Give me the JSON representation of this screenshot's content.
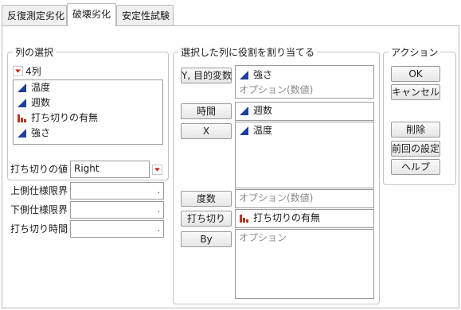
{
  "tabs": [
    "反復測定劣化",
    "破壊劣化",
    "安定性試験"
  ],
  "column_select": {
    "title": "列の選択",
    "count_label": "4列",
    "columns": [
      {
        "label": "温度",
        "icon": "continuous-icon"
      },
      {
        "label": "週数",
        "icon": "continuous-icon"
      },
      {
        "label": "打ち切りの有無",
        "icon": "nominal-bar-icon"
      },
      {
        "label": "強さ",
        "icon": "continuous-icon"
      }
    ]
  },
  "censor_value": {
    "label": "打ち切りの値",
    "value": "Right"
  },
  "upper_spec": {
    "label": "上側仕様限界",
    "value": "."
  },
  "lower_spec": {
    "label": "下側仕様限界",
    "value": "."
  },
  "censor_time": {
    "label": "打ち切り時間",
    "value": "."
  },
  "assign_roles": {
    "title": "選択した列に役割を割り当てる",
    "roles": {
      "y": {
        "button": "Y, 目的変数",
        "items": [
          "強さ"
        ],
        "placeholder": "オプション(数値)"
      },
      "time": {
        "button": "時間",
        "items": [
          "週数"
        ]
      },
      "x": {
        "button": "X",
        "items": [
          "温度"
        ]
      },
      "freq": {
        "button": "度数",
        "placeholder": "オプション(数値)"
      },
      "censor": {
        "button": "打ち切り",
        "items": [
          "打ち切りの有無"
        ]
      },
      "by": {
        "button": "By",
        "placeholder": "オプション"
      }
    }
  },
  "actions": {
    "title": "アクション",
    "ok": "OK",
    "cancel": "キャンセル",
    "remove": "削除",
    "recall": "前回の設定",
    "help": "ヘルプ"
  },
  "colors": {
    "continuous": "#1f3f9e",
    "nominal": "#b5351e",
    "dropdown": "#d0221c"
  }
}
